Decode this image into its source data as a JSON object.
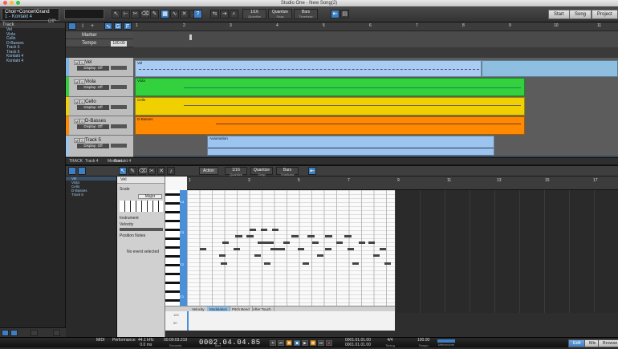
{
  "window": {
    "title": "Studio One - New Song(2)"
  },
  "toolbar": {
    "preset_name": "Choir+ConcertGrand",
    "preset_sub": "1 - Kontakt 4",
    "preset_tag": "Off*",
    "fields": [
      {
        "value": "1/16",
        "label": "Quantize"
      },
      {
        "value": "Quantize",
        "label": "Snap"
      },
      {
        "value": "Bars",
        "label": "Timebase"
      }
    ],
    "nav": [
      "Start",
      "Song",
      "Project"
    ]
  },
  "browser": {
    "header": "Track",
    "items": [
      "Vel",
      "Viola",
      "Cello",
      "D-Basses",
      "Track 5",
      "Track 6",
      "Kontakt 4",
      "Kontakt 4"
    ]
  },
  "arrange": {
    "ruler": [
      "1",
      "2",
      "3",
      "4",
      "5",
      "6",
      "7",
      "8",
      "9",
      "10",
      "11",
      "12"
    ],
    "global_tracks": [
      {
        "name": "Marker",
        "value": ""
      },
      {
        "name": "Tempo",
        "value": "100.00"
      }
    ],
    "tracks": [
      {
        "name": "Vel",
        "display": "Display: Off",
        "color": "#7fb4e8"
      },
      {
        "name": "Viola",
        "display": "Display: Off",
        "color": "#34d13e"
      },
      {
        "name": "Cello",
        "display": "Display: Off",
        "color": "#f0d000"
      },
      {
        "name": "D-Basses",
        "display": "Display: Off",
        "color": "#ff8a00"
      },
      {
        "name": "Track 5",
        "display": "Display: Off",
        "color": "#9bc4ee"
      }
    ],
    "clip_labels": [
      "Vel",
      "Viola",
      "Cello",
      "D-Basses",
      "Automation"
    ],
    "footer": [
      "TRACK",
      "Track 4",
      "Kontakt 4",
      "Medium"
    ]
  },
  "editor": {
    "action_label": "Action",
    "fields": [
      {
        "value": "1/16",
        "label": "Quantize"
      },
      {
        "value": "Quantize",
        "label": "Snap"
      },
      {
        "value": "Bars",
        "label": "Timebase"
      }
    ],
    "tracks": [
      "Vel",
      "Viola",
      "Cello",
      "D-Basses",
      "Track 5"
    ],
    "inspector": {
      "title": "Vel",
      "scale_label": "Scale",
      "scale_value": "Major",
      "instrument_label": "Instrument",
      "velocity_label": "Velocity",
      "position_label": "Position Notes",
      "no_event": "No event selected"
    },
    "ruler": [
      "1",
      "3",
      "5",
      "7",
      "9",
      "11",
      "13",
      "15",
      "17"
    ],
    "piano_labels": [
      "C4",
      "C3",
      "C2",
      "C1"
    ],
    "lane_tabs": [
      "Velocity",
      "Modulation",
      "Pitch Bend",
      "After Touch"
    ],
    "vel_labels": [
      "100",
      "50"
    ]
  },
  "transport": {
    "cpu_label": "MIDI",
    "perf_label": "Performance",
    "sample_rate": "44.1 kHz",
    "latency": "0.0 ms",
    "time": "00:00:03.219",
    "time_label": "Seconds",
    "bars": "0002.04.04.85",
    "bars_label": "Bars",
    "loop_start": "0001.01.01.00",
    "loop_end": "0001.01.01.00",
    "meter": "4/4",
    "meter_label": "Timing",
    "tempo": "100.00",
    "tempo_label": "Tempo",
    "metronome_label": "Metronome",
    "nav": [
      "Edit",
      "Mix",
      "Browse"
    ]
  }
}
